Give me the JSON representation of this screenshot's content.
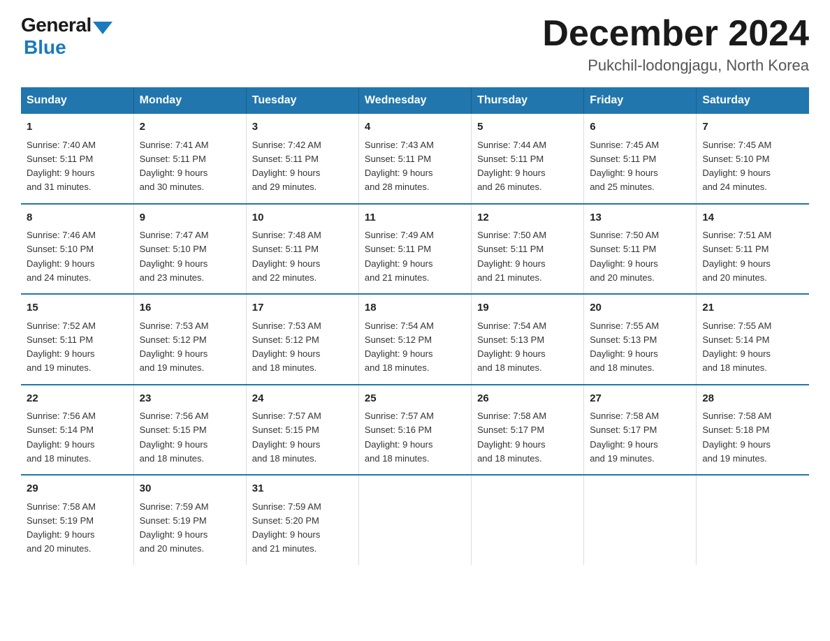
{
  "logo": {
    "general": "General",
    "blue": "Blue"
  },
  "header": {
    "title": "December 2024",
    "subtitle": "Pukchil-lodongjagu, North Korea"
  },
  "weekdays": [
    "Sunday",
    "Monday",
    "Tuesday",
    "Wednesday",
    "Thursday",
    "Friday",
    "Saturday"
  ],
  "weeks": [
    [
      {
        "day": "1",
        "sunrise": "7:40 AM",
        "sunset": "5:11 PM",
        "daylight": "9 hours and 31 minutes."
      },
      {
        "day": "2",
        "sunrise": "7:41 AM",
        "sunset": "5:11 PM",
        "daylight": "9 hours and 30 minutes."
      },
      {
        "day": "3",
        "sunrise": "7:42 AM",
        "sunset": "5:11 PM",
        "daylight": "9 hours and 29 minutes."
      },
      {
        "day": "4",
        "sunrise": "7:43 AM",
        "sunset": "5:11 PM",
        "daylight": "9 hours and 28 minutes."
      },
      {
        "day": "5",
        "sunrise": "7:44 AM",
        "sunset": "5:11 PM",
        "daylight": "9 hours and 26 minutes."
      },
      {
        "day": "6",
        "sunrise": "7:45 AM",
        "sunset": "5:11 PM",
        "daylight": "9 hours and 25 minutes."
      },
      {
        "day": "7",
        "sunrise": "7:45 AM",
        "sunset": "5:10 PM",
        "daylight": "9 hours and 24 minutes."
      }
    ],
    [
      {
        "day": "8",
        "sunrise": "7:46 AM",
        "sunset": "5:10 PM",
        "daylight": "9 hours and 24 minutes."
      },
      {
        "day": "9",
        "sunrise": "7:47 AM",
        "sunset": "5:10 PM",
        "daylight": "9 hours and 23 minutes."
      },
      {
        "day": "10",
        "sunrise": "7:48 AM",
        "sunset": "5:11 PM",
        "daylight": "9 hours and 22 minutes."
      },
      {
        "day": "11",
        "sunrise": "7:49 AM",
        "sunset": "5:11 PM",
        "daylight": "9 hours and 21 minutes."
      },
      {
        "day": "12",
        "sunrise": "7:50 AM",
        "sunset": "5:11 PM",
        "daylight": "9 hours and 21 minutes."
      },
      {
        "day": "13",
        "sunrise": "7:50 AM",
        "sunset": "5:11 PM",
        "daylight": "9 hours and 20 minutes."
      },
      {
        "day": "14",
        "sunrise": "7:51 AM",
        "sunset": "5:11 PM",
        "daylight": "9 hours and 20 minutes."
      }
    ],
    [
      {
        "day": "15",
        "sunrise": "7:52 AM",
        "sunset": "5:11 PM",
        "daylight": "9 hours and 19 minutes."
      },
      {
        "day": "16",
        "sunrise": "7:53 AM",
        "sunset": "5:12 PM",
        "daylight": "9 hours and 19 minutes."
      },
      {
        "day": "17",
        "sunrise": "7:53 AM",
        "sunset": "5:12 PM",
        "daylight": "9 hours and 18 minutes."
      },
      {
        "day": "18",
        "sunrise": "7:54 AM",
        "sunset": "5:12 PM",
        "daylight": "9 hours and 18 minutes."
      },
      {
        "day": "19",
        "sunrise": "7:54 AM",
        "sunset": "5:13 PM",
        "daylight": "9 hours and 18 minutes."
      },
      {
        "day": "20",
        "sunrise": "7:55 AM",
        "sunset": "5:13 PM",
        "daylight": "9 hours and 18 minutes."
      },
      {
        "day": "21",
        "sunrise": "7:55 AM",
        "sunset": "5:14 PM",
        "daylight": "9 hours and 18 minutes."
      }
    ],
    [
      {
        "day": "22",
        "sunrise": "7:56 AM",
        "sunset": "5:14 PM",
        "daylight": "9 hours and 18 minutes."
      },
      {
        "day": "23",
        "sunrise": "7:56 AM",
        "sunset": "5:15 PM",
        "daylight": "9 hours and 18 minutes."
      },
      {
        "day": "24",
        "sunrise": "7:57 AM",
        "sunset": "5:15 PM",
        "daylight": "9 hours and 18 minutes."
      },
      {
        "day": "25",
        "sunrise": "7:57 AM",
        "sunset": "5:16 PM",
        "daylight": "9 hours and 18 minutes."
      },
      {
        "day": "26",
        "sunrise": "7:58 AM",
        "sunset": "5:17 PM",
        "daylight": "9 hours and 18 minutes."
      },
      {
        "day": "27",
        "sunrise": "7:58 AM",
        "sunset": "5:17 PM",
        "daylight": "9 hours and 19 minutes."
      },
      {
        "day": "28",
        "sunrise": "7:58 AM",
        "sunset": "5:18 PM",
        "daylight": "9 hours and 19 minutes."
      }
    ],
    [
      {
        "day": "29",
        "sunrise": "7:58 AM",
        "sunset": "5:19 PM",
        "daylight": "9 hours and 20 minutes."
      },
      {
        "day": "30",
        "sunrise": "7:59 AM",
        "sunset": "5:19 PM",
        "daylight": "9 hours and 20 minutes."
      },
      {
        "day": "31",
        "sunrise": "7:59 AM",
        "sunset": "5:20 PM",
        "daylight": "9 hours and 21 minutes."
      },
      null,
      null,
      null,
      null
    ]
  ],
  "labels": {
    "sunrise": "Sunrise:",
    "sunset": "Sunset:",
    "daylight": "Daylight:"
  }
}
